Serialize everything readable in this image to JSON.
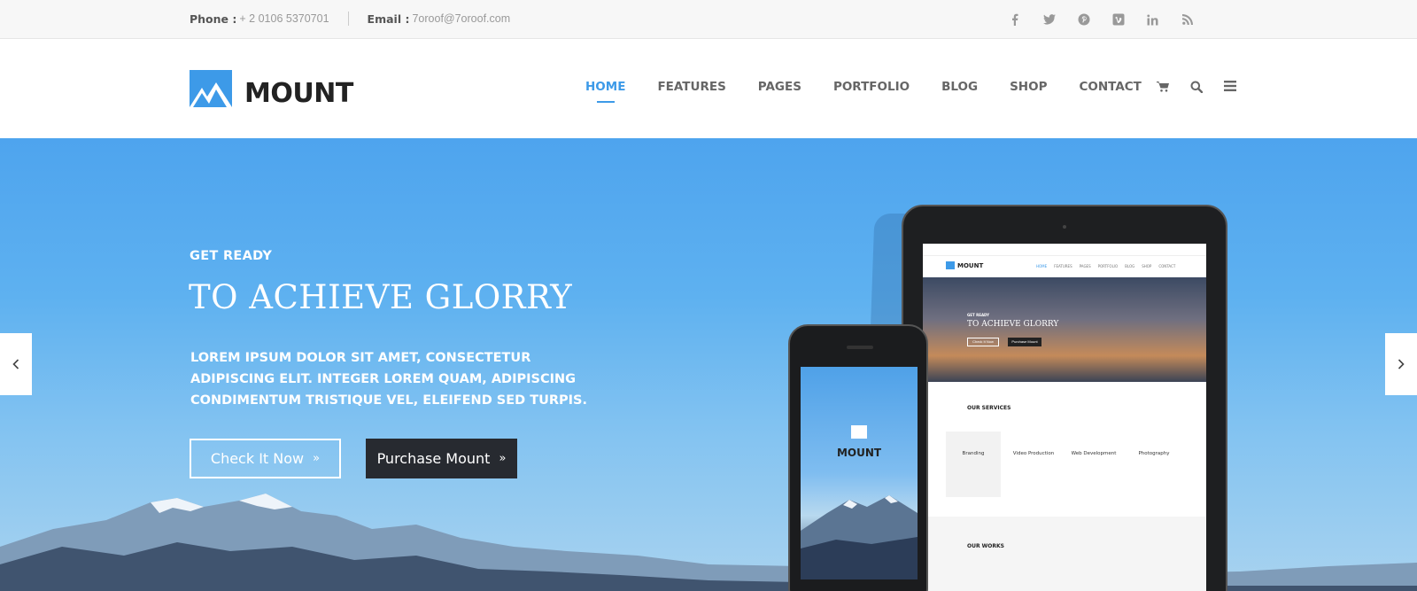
{
  "topbar": {
    "phone_label": "Phone :",
    "phone_value": "+ 2 0106 5370701",
    "email_label": "Email :",
    "email_value": "7oroof@7oroof.com",
    "social_icons": [
      "facebook-icon",
      "twitter-icon",
      "pinterest-icon",
      "vimeo-icon",
      "linkedin-icon",
      "rss-icon"
    ]
  },
  "header": {
    "logo_text": "MOUNT",
    "nav": [
      "HOME",
      "FEATURES",
      "PAGES",
      "PORTFOLIO",
      "BLOG",
      "SHOP",
      "CONTACT"
    ],
    "active_nav": "HOME",
    "icons": [
      "cart-icon",
      "search-icon",
      "menu-icon"
    ]
  },
  "hero": {
    "pre_title": "GET READY",
    "title": "TO ACHIEVE GLORRY",
    "lead": "LOREM IPSUM DOLOR SIT AMET, CONSECTETUR ADIPISCING ELIT. INTEGER LOREM QUAM, ADIPISCING CONDIMENTUM TRISTIQUE VEL, ELEIFEND SED TURPIS.",
    "button_primary": "Check It Now",
    "button_secondary": "Purchase Mount",
    "prev_icon": "chevron-left-icon",
    "next_icon": "chevron-right-icon"
  },
  "tablet_screen": {
    "logo_text": "MOUNT",
    "nav": [
      "HOME",
      "FEATURES",
      "PAGES",
      "PORTFOLIO",
      "BLOG",
      "SHOP",
      "CONTACT"
    ],
    "pre_title": "GET READY",
    "title": "TO ACHIEVE GLORRY",
    "button_primary": "Check It Now",
    "button_secondary": "Purchase Mount",
    "services_heading": "OUR SERVICES",
    "services": [
      "Branding",
      "Video Production",
      "Web Development",
      "Photography"
    ],
    "works_heading": "OUR WORKS"
  },
  "phone_screen": {
    "logo_text": "MOUNT"
  },
  "colors": {
    "accent": "#3d9ae8",
    "dark_button": "#272a30"
  }
}
